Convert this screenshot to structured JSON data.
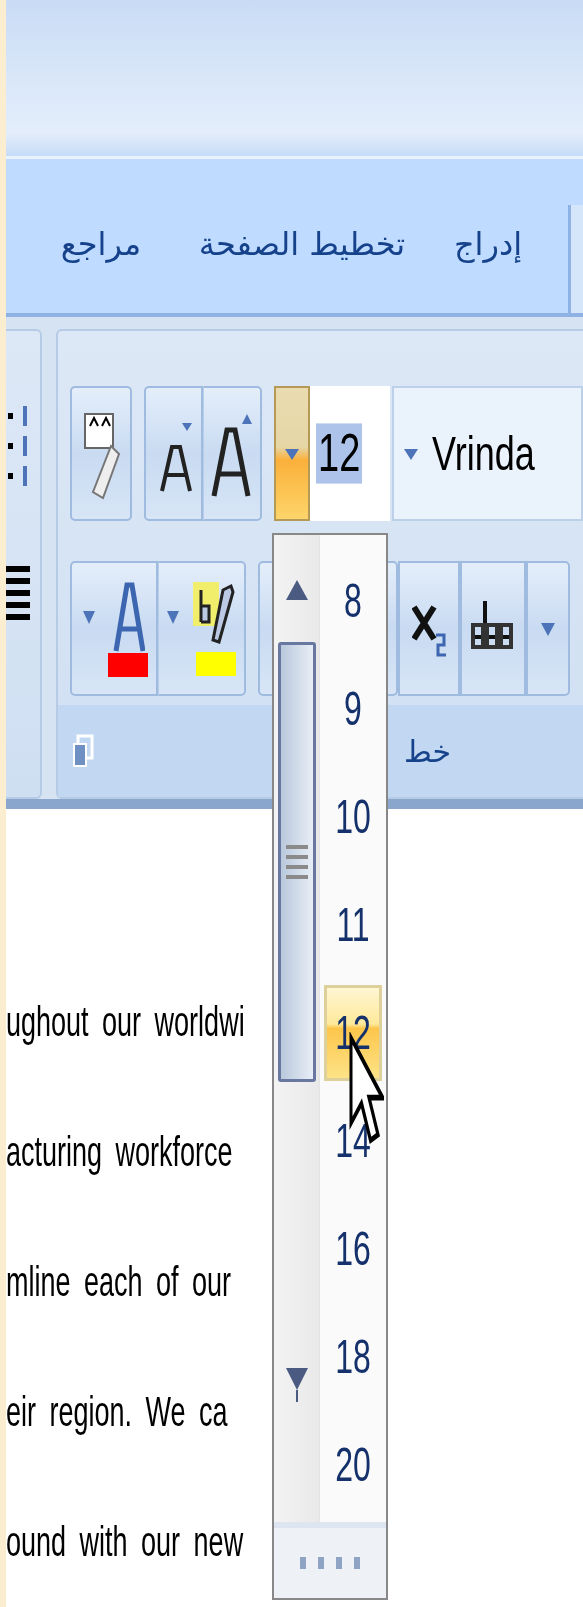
{
  "ribbon_tabs": [
    {
      "label": "إدراج",
      "selected": false
    },
    {
      "label": "تخطيط الصفحة",
      "selected": false
    },
    {
      "label": "مراجع",
      "selected": false
    }
  ],
  "font_group": {
    "label": "خط",
    "font_size": "12",
    "font_name": "Vrinda"
  },
  "font_size_list": {
    "items": [
      {
        "label": "8",
        "selected": false
      },
      {
        "label": "9",
        "selected": false
      },
      {
        "label": "10",
        "selected": false
      },
      {
        "label": "11",
        "selected": false
      },
      {
        "label": "12",
        "selected": true
      },
      {
        "label": "14",
        "selected": false
      },
      {
        "label": "16",
        "selected": false
      },
      {
        "label": "18",
        "selected": false
      },
      {
        "label": "20",
        "selected": false
      }
    ]
  },
  "document": {
    "lines": [
      "ughout our worldwi",
      "acturing workforce",
      "mline each of our",
      "eir region. We ca",
      "ound with our new"
    ]
  }
}
